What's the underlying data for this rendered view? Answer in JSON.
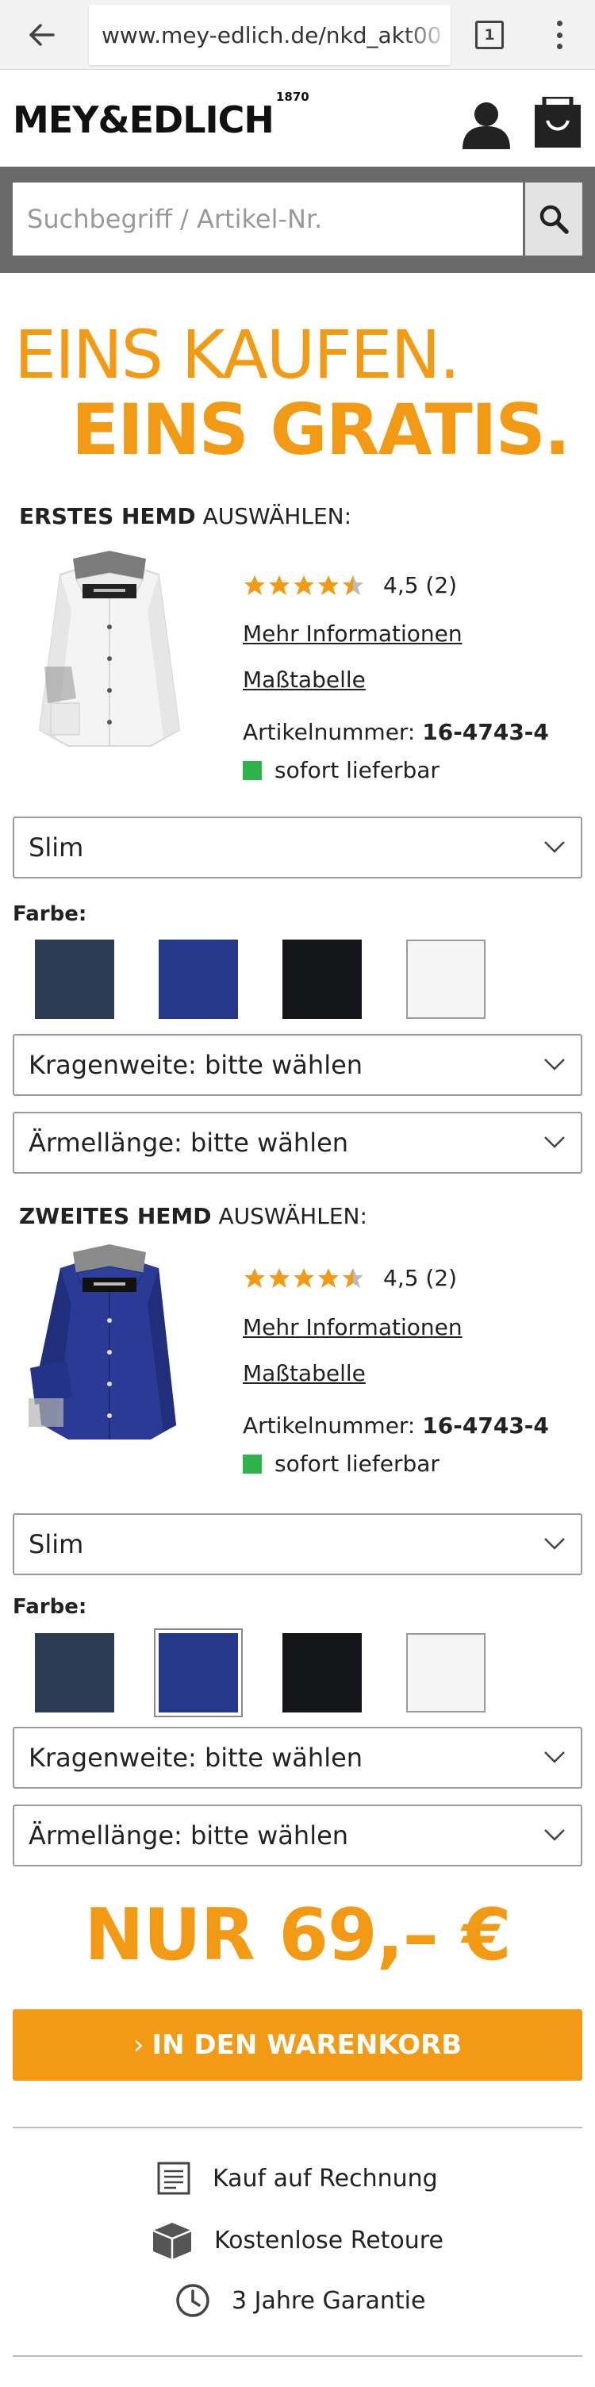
{
  "browser": {
    "url": "www.mey-edlich.de/nkd_akt00",
    "tab_count": "1"
  },
  "header": {
    "logo": "MEY&EDLICH",
    "logo_year": "1870"
  },
  "search": {
    "placeholder": "Suchbegriff / Artikel-Nr."
  },
  "hero": {
    "line1": "EINS KAUFEN.",
    "line2": "EINS GRATIS."
  },
  "first_shirt": {
    "heading_bold": "ERSTES HEMD",
    "heading_rest": " AUSWÄHLEN:",
    "rating": 4.5,
    "rating_text": "4,5 (2)",
    "more_info": "Mehr Informationen",
    "size_chart": "Maßtabelle",
    "article_label": "Artikelnummer: ",
    "article_number": "16-4743-4",
    "stock": "sofort lieferbar",
    "fit": "Slim",
    "color_label": "Farbe:",
    "colors": [
      "#2c3b52",
      "#26388a",
      "#141519",
      "#f5f5f5"
    ],
    "collar": "Kragenweite: bitte wählen",
    "sleeve": "Ärmellänge: bitte wählen"
  },
  "second_shirt": {
    "heading_bold": "ZWEITES HEMD",
    "heading_rest": " AUSWÄHLEN:",
    "rating": 4.5,
    "rating_text": "4,5 (2)",
    "more_info": "Mehr Informationen",
    "size_chart": "Maßtabelle",
    "article_label": "Artikelnummer: ",
    "article_number": "16-4743-4",
    "stock": "sofort lieferbar",
    "fit": "Slim",
    "color_label": "Farbe:",
    "colors": [
      "#2c3b52",
      "#26388a",
      "#141519",
      "#f5f5f5"
    ],
    "selected_color": 2,
    "collar": "Kragenweite: bitte wählen",
    "sleeve": "Ärmellänge: bitte wählen"
  },
  "price": "NUR 69,– €",
  "cart_button": "IN DEN WARENKORB",
  "benefits": {
    "invoice": "Kauf auf Rechnung",
    "return": "Kostenlose Retoure",
    "warranty": "3 Jahre Garantie"
  },
  "colors": {
    "accent": "#f39a14",
    "in_stock": "#2db34a",
    "search_band": "#6a6a6a"
  }
}
